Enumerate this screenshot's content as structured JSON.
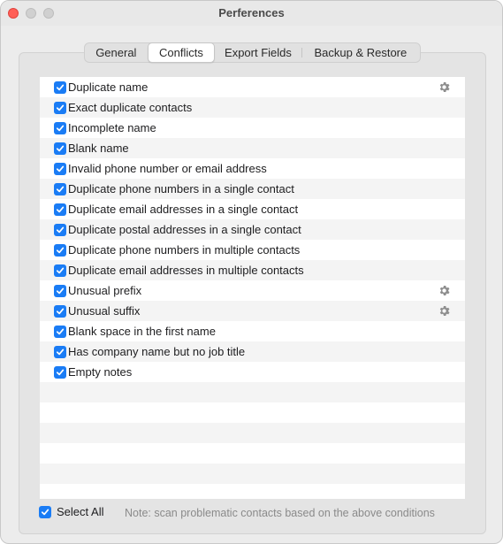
{
  "window": {
    "title": "Perferences"
  },
  "tabs": [
    {
      "label": "General",
      "active": false
    },
    {
      "label": "Conflicts",
      "active": true
    },
    {
      "label": "Export Fields",
      "active": false
    },
    {
      "label": "Backup & Restore",
      "active": false
    }
  ],
  "conflicts": [
    {
      "label": "Duplicate name",
      "checked": true,
      "has_settings": true
    },
    {
      "label": "Exact duplicate contacts",
      "checked": true,
      "has_settings": false
    },
    {
      "label": "Incomplete name",
      "checked": true,
      "has_settings": false
    },
    {
      "label": "Blank name",
      "checked": true,
      "has_settings": false
    },
    {
      "label": "Invalid phone number or email address",
      "checked": true,
      "has_settings": false
    },
    {
      "label": "Duplicate phone numbers in a single contact",
      "checked": true,
      "has_settings": false
    },
    {
      "label": "Duplicate email addresses in a single contact",
      "checked": true,
      "has_settings": false
    },
    {
      "label": "Duplicate postal addresses in a single contact",
      "checked": true,
      "has_settings": false
    },
    {
      "label": "Duplicate phone numbers in multiple contacts",
      "checked": true,
      "has_settings": false
    },
    {
      "label": "Duplicate email addresses in multiple contacts",
      "checked": true,
      "has_settings": false
    },
    {
      "label": "Unusual prefix",
      "checked": true,
      "has_settings": true
    },
    {
      "label": "Unusual suffix",
      "checked": true,
      "has_settings": true
    },
    {
      "label": "Blank space in the first name",
      "checked": true,
      "has_settings": false
    },
    {
      "label": "Has company name but no job title",
      "checked": true,
      "has_settings": false
    },
    {
      "label": "Empty notes",
      "checked": true,
      "has_settings": false
    }
  ],
  "footer": {
    "select_all_label": "Select All",
    "select_all_checked": true,
    "note": "Note: scan problematic contacts based on the above conditions"
  },
  "colors": {
    "checkbox": "#1a7cf5",
    "close_button": "#ff5f57"
  },
  "icons": {
    "settings": "gear-icon",
    "check": "checkmark-icon"
  }
}
